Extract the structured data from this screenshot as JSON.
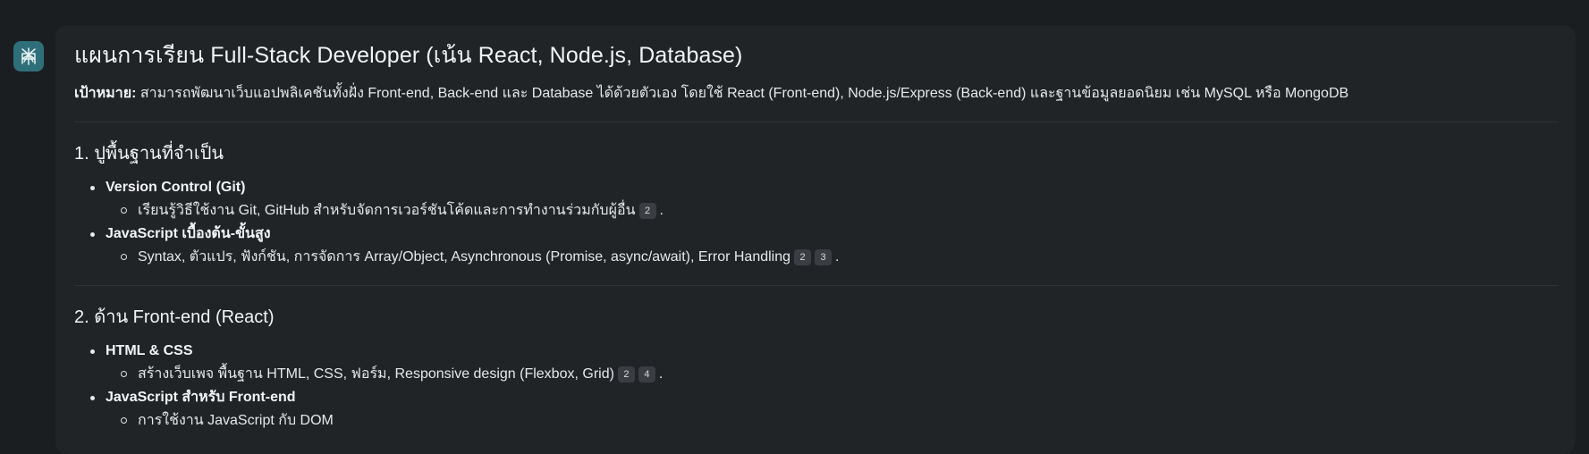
{
  "assistant": {
    "avatar_icon": "perplexity-logo-icon",
    "avatar_color": "#2f6f7a"
  },
  "answer": {
    "title": "แผนการเรียน Full-Stack Developer (เน้น React, Node.js, Database)",
    "goal_label": "เป้าหมาย:",
    "goal_text": "สามารถพัฒนาเว็บแอปพลิเคชันทั้งฝั่ง Front-end, Back-end และ Database ได้ด้วยตัวเอง โดยใช้ React (Front-end), Node.js/Express (Back-end) และฐานข้อมูลยอดนิยม เช่น MySQL หรือ MongoDB",
    "sections": [
      {
        "heading": "1. ปูพื้นฐานที่จำเป็น",
        "items": [
          {
            "label": "Version Control (Git)",
            "sub": [
              {
                "text": "เรียนรู้วิธีใช้งาน Git, GitHub สำหรับจัดการเวอร์ชันโค้ดและการทำงานร่วมกับผู้อื่น",
                "citations": [
                  "2"
                ]
              }
            ]
          },
          {
            "label": "JavaScript เบื้องต้น-ขั้นสูง",
            "sub": [
              {
                "text": "Syntax, ตัวแปร, ฟังก์ชัน, การจัดการ Array/Object, Asynchronous (Promise, async/await), Error Handling",
                "citations": [
                  "2",
                  "3"
                ]
              }
            ]
          }
        ]
      },
      {
        "heading": "2. ด้าน Front-end (React)",
        "items": [
          {
            "label": "HTML & CSS",
            "sub": [
              {
                "text": "สร้างเว็บเพจ พื้นฐาน HTML, CSS, ฟอร์ม, Responsive design (Flexbox, Grid)",
                "citations": [
                  "2",
                  "4"
                ]
              }
            ]
          },
          {
            "label": "JavaScript สำหรับ Front-end",
            "sub": [
              {
                "text": "การใช้งาน JavaScript กับ DOM",
                "citations": []
              }
            ]
          }
        ]
      }
    ],
    "period": "."
  }
}
